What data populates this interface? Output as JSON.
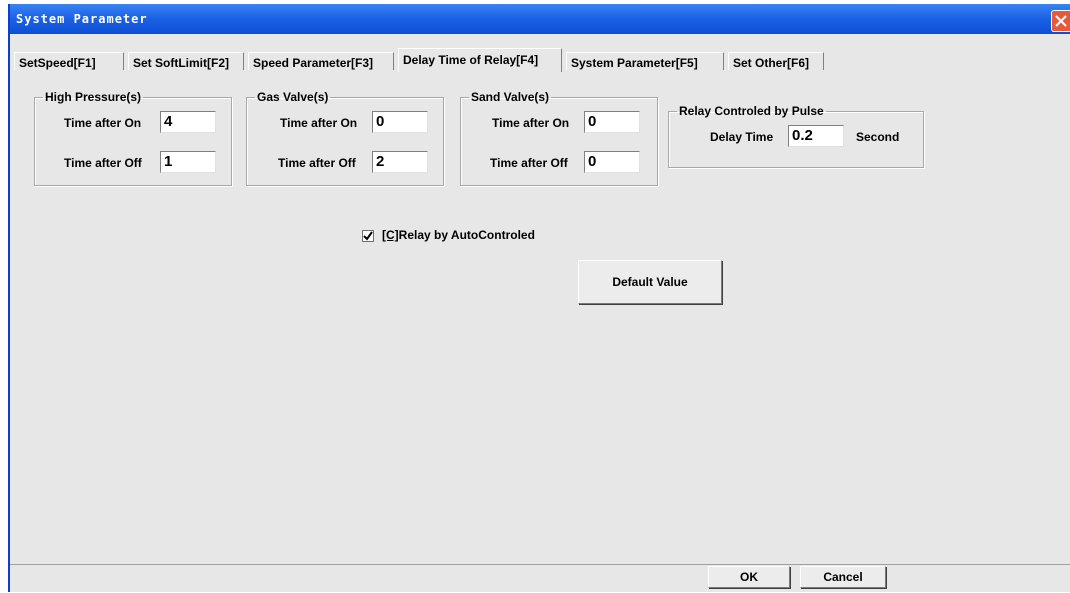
{
  "window": {
    "title": "System Parameter",
    "colors": {
      "titlebar": "#1d63e6",
      "close": "#e55a3d",
      "face": "#e7e7e7"
    }
  },
  "tabs": [
    {
      "label": "SetSpeed[F1]",
      "active": false
    },
    {
      "label": "Set SoftLimit[F2]",
      "active": false
    },
    {
      "label": "Speed Parameter[F3]",
      "active": false
    },
    {
      "label": "Delay Time of Relay[F4]",
      "active": true
    },
    {
      "label": "System Parameter[F5]",
      "active": false
    },
    {
      "label": "Set Other[F6]",
      "active": false
    }
  ],
  "groups": {
    "high_pressure": {
      "title": "High Pressure(s)",
      "on_label": "Time after On",
      "on_value": "4",
      "off_label": "Time after Off",
      "off_value": "1"
    },
    "gas_valve": {
      "title": "Gas Valve(s)",
      "on_label": "Time after On",
      "on_value": "0",
      "off_label": "Time after Off",
      "off_value": "2"
    },
    "sand_valve": {
      "title": "Sand Valve(s)",
      "on_label": "Time after On",
      "on_value": "0",
      "off_label": "Time after Off",
      "off_value": "0"
    },
    "pulse": {
      "title": "Relay Controled by Pulse",
      "delay_label": "Delay Time",
      "delay_value": "0.2",
      "unit": "Second"
    }
  },
  "checkbox": {
    "mnemonic": "[C]",
    "label": "Relay by AutoControled",
    "checked": true
  },
  "buttons": {
    "default": "Default Value",
    "ok": "OK",
    "cancel": "Cancel"
  }
}
